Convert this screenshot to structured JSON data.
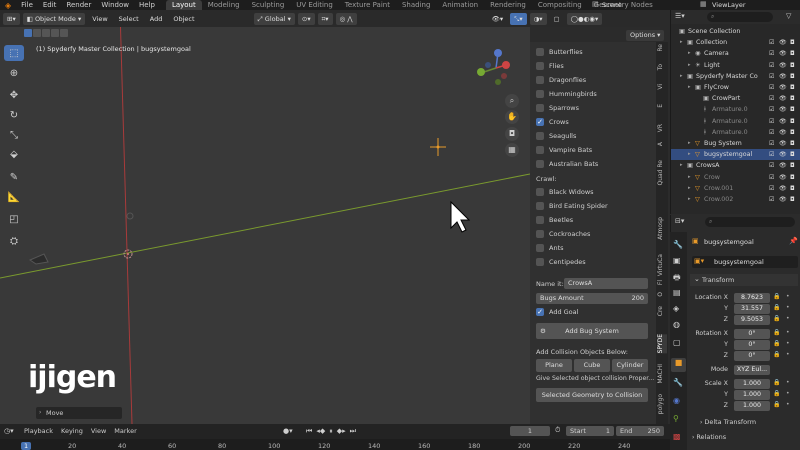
{
  "topmenu": {
    "items": [
      "File",
      "Edit",
      "Render",
      "Window",
      "Help"
    ],
    "workspaces": [
      "Layout",
      "Modeling",
      "Sculpting",
      "UV Editing",
      "Texture Paint",
      "Shading",
      "Animation",
      "Rendering",
      "Compositing",
      "Geometry Nodes"
    ],
    "active_workspace": "Layout",
    "scene": "Scene",
    "view_layer": "ViewLayer"
  },
  "viewport_header": {
    "mode": "Object Mode",
    "menus": [
      "View",
      "Select",
      "Add",
      "Object"
    ],
    "transform": "Global",
    "options": "Options"
  },
  "viewport": {
    "info": "(1) Spyderfy Master Collection | bugsystemgoal",
    "last_op": "Move",
    "logo": "ijigen"
  },
  "bugs_panel": {
    "flyers": [
      {
        "label": "Butterflies",
        "checked": false
      },
      {
        "label": "Flies",
        "checked": false
      },
      {
        "label": "Dragonflies",
        "checked": false
      },
      {
        "label": "Hummingbirds",
        "checked": false
      },
      {
        "label": "Sparrows",
        "checked": false
      },
      {
        "label": "Crows",
        "checked": true
      },
      {
        "label": "Seagulls",
        "checked": false
      },
      {
        "label": "Vampire Bats",
        "checked": false
      },
      {
        "label": "Australian Bats",
        "checked": false
      }
    ],
    "crawl_label": "Crawl:",
    "crawlers": [
      {
        "label": "Black Widows",
        "checked": false
      },
      {
        "label": "Bird Eating Spider",
        "checked": false
      },
      {
        "label": "Beetles",
        "checked": false
      },
      {
        "label": "Cockroaches",
        "checked": false
      },
      {
        "label": "Ants",
        "checked": false
      },
      {
        "label": "Centipedes",
        "checked": false
      }
    ],
    "name_label": "Name it:",
    "name_value": "CrowsA",
    "bugs_amount_label": "Bugs Amount",
    "bugs_amount_value": "200",
    "add_goal": "Add Goal",
    "add_bug_system": "Add Bug System",
    "collision_label": "Add Collision Objects Below:",
    "collision_buttons": [
      "Plane",
      "Cube",
      "Cylinder"
    ],
    "collision_hint": "Give Selected object collision Proper...",
    "collision_button": "Selected Geometry to Collision"
  },
  "side_tabs": [
    "Re",
    "To",
    "Vi",
    "E",
    "VR",
    "A",
    "Quad Re",
    "Atmosp",
    "VirtuCa",
    "Fl",
    "O",
    "Cre",
    "SPYDE",
    "MACHI",
    "polygo"
  ],
  "outliner": {
    "rows": [
      {
        "label": "Scene Collection",
        "indent": 0,
        "icon": "▣",
        "sel": false,
        "dim": false
      },
      {
        "label": "Collection",
        "indent": 1,
        "icon": "▣",
        "sel": false,
        "dim": false
      },
      {
        "label": "Camera",
        "indent": 2,
        "icon": "◉",
        "sel": false,
        "dim": false
      },
      {
        "label": "Light",
        "indent": 2,
        "icon": "☀",
        "sel": false,
        "dim": false
      },
      {
        "label": "Spyderfy Master Co",
        "indent": 1,
        "icon": "▣",
        "sel": false,
        "dim": false
      },
      {
        "label": "FlyCrow",
        "indent": 2,
        "icon": "▣",
        "sel": false,
        "dim": false
      },
      {
        "label": "CrowPart",
        "indent": 3,
        "icon": "▣",
        "sel": false,
        "dim": false
      },
      {
        "label": "Armature.0",
        "indent": 3,
        "icon": "ᚼ",
        "sel": false,
        "dim": true
      },
      {
        "label": "Armature.0",
        "indent": 3,
        "icon": "ᚼ",
        "sel": false,
        "dim": true
      },
      {
        "label": "Armature.0",
        "indent": 3,
        "icon": "ᚼ",
        "sel": false,
        "dim": true
      },
      {
        "label": "Bug System",
        "indent": 2,
        "icon": "▽",
        "sel": false,
        "dim": false
      },
      {
        "label": "bugsystemgoal",
        "indent": 2,
        "icon": "▽",
        "sel": true,
        "dim": false
      },
      {
        "label": "CrowsA",
        "indent": 1,
        "icon": "▣",
        "sel": false,
        "dim": false
      },
      {
        "label": "Crow",
        "indent": 2,
        "icon": "▽",
        "sel": false,
        "dim": true
      },
      {
        "label": "Crow.001",
        "indent": 2,
        "icon": "▽",
        "sel": false,
        "dim": true
      },
      {
        "label": "Crow.002",
        "indent": 2,
        "icon": "▽",
        "sel": false,
        "dim": true
      }
    ]
  },
  "properties": {
    "object_name": "bugsystemgoal",
    "object_field": "bugsystemgoal",
    "transform": "Transform",
    "location_label": "Location X",
    "location": [
      "8.7623",
      "31.557",
      "9.5053"
    ],
    "rotation_label": "Rotation X",
    "rotation": [
      "0°",
      "0°",
      "0°"
    ],
    "mode_label": "Mode",
    "mode": "XYZ Eul...",
    "scale_label": "Scale X",
    "scale": [
      "1.000",
      "1.000",
      "1.000"
    ],
    "y": "Y",
    "z": "Z",
    "delta_transform": "Delta Transform",
    "relations": "Relations"
  },
  "timeline": {
    "menus": [
      "Playback",
      "Keying",
      "View",
      "Marker"
    ],
    "current_frame": "1",
    "start_label": "Start",
    "start": "1",
    "end_label": "End",
    "end": "250",
    "ruler": [
      "1",
      "20",
      "40",
      "60",
      "80",
      "100",
      "120",
      "140",
      "160",
      "180",
      "200",
      "220",
      "240"
    ]
  },
  "colors": {
    "accent": "#4772b3",
    "selection": "#334d80",
    "x_axis": "#a83b3b",
    "y_axis": "#7a9a2e"
  }
}
